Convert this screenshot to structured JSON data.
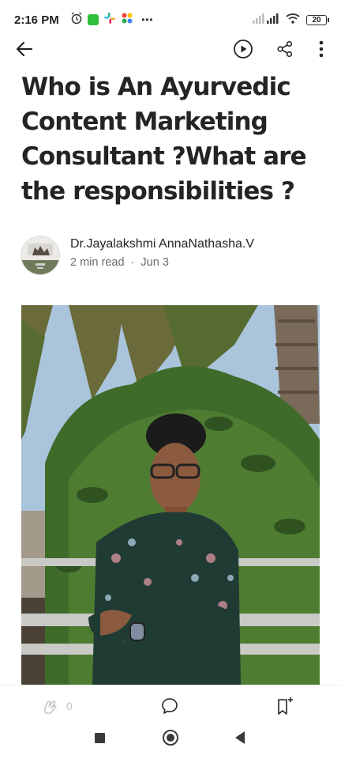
{
  "status_bar": {
    "time": "2:16 PM",
    "battery": "20",
    "more": "⋯"
  },
  "toolbar": {
    "back_icon": "arrow-left-icon",
    "play_icon": "play-circle-icon",
    "share_icon": "share-icon",
    "more_icon": "more-vertical-icon"
  },
  "article": {
    "title": "Who is An Ayurvedic Content Marketing Consultant ?What are the responsibilities ?",
    "author": "Dr.Jayalakshmi AnnaNathasha.V",
    "read_time": "2 min read",
    "separator": "·",
    "date": "Jun 3"
  },
  "actions": {
    "clap_count": "0",
    "clap_icon": "clap-icon",
    "comment_icon": "comment-icon",
    "bookmark_icon": "bookmark-add-icon"
  },
  "colors": {
    "text": "#242424",
    "muted": "#6b6b6b",
    "icon": "#242424"
  }
}
